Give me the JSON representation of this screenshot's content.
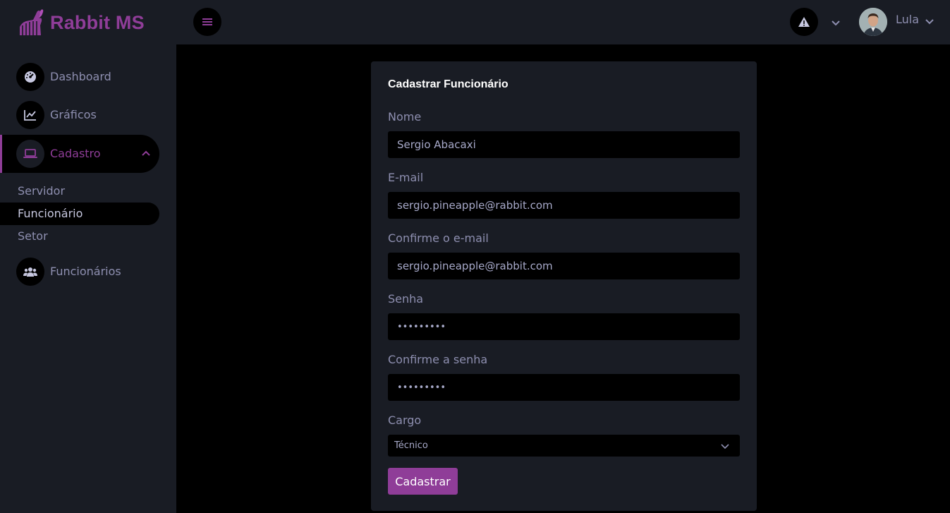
{
  "brand": {
    "name": "Rabbit MS",
    "color": "#8f3d98"
  },
  "header": {
    "menu_icon": "hamburger-icon",
    "alert_icon": "warning-icon",
    "user": {
      "name": "Lula"
    }
  },
  "sidebar": {
    "items": [
      {
        "label": "Dashboard",
        "icon": "speedometer-icon"
      },
      {
        "label": "Gráficos",
        "icon": "chart-line-icon"
      },
      {
        "label": "Cadastro",
        "icon": "laptop-icon",
        "expanded": true
      },
      {
        "label": "Funcionários",
        "icon": "users-icon"
      }
    ],
    "subitems": [
      {
        "label": "Servidor"
      },
      {
        "label": "Funcionário",
        "active": true
      },
      {
        "label": "Setor"
      }
    ]
  },
  "form": {
    "title": "Cadastrar Funcionário",
    "fields": {
      "nome": {
        "label": "Nome",
        "value": "Sergio Abacaxi"
      },
      "email": {
        "label": "E-mail",
        "value": "sergio.pineapple@rabbit.com"
      },
      "email_confirm": {
        "label": "Confirme o e-mail",
        "value": "sergio.pineapple@rabbit.com"
      },
      "senha": {
        "label": "Senha",
        "value": "•••••••••"
      },
      "senha_confirm": {
        "label": "Confirme a senha",
        "value": "•••••••••"
      },
      "cargo": {
        "label": "Cargo",
        "value": "Técnico"
      }
    },
    "submit_label": "Cadastrar"
  },
  "colors": {
    "accent": "#8f3d98",
    "panel": "#191c24",
    "background": "#000000",
    "muted_text": "#8e8fb0"
  }
}
